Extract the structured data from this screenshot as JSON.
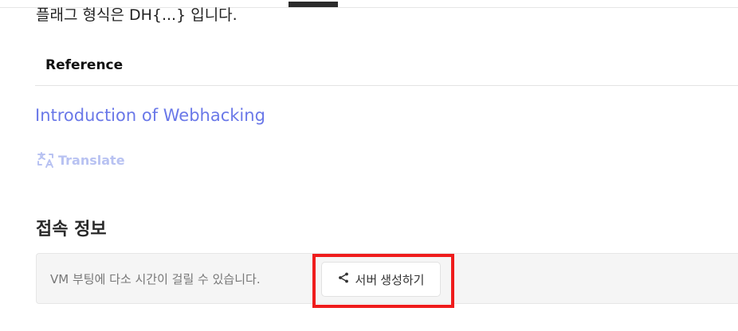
{
  "flag_format_text": "플래그 형식은 DH{...} 입니다.",
  "reference": {
    "heading": "Reference",
    "link_text": "Introduction of Webhacking"
  },
  "translate": {
    "label": "Translate",
    "icon": "translate-icon"
  },
  "connection": {
    "title": "접속 정보",
    "notice": "VM 부팅에 다소 시간이 걸릴 수 있습니다.",
    "server_button_label": "서버 생성하기",
    "server_button_icon": "share-icon"
  },
  "colors": {
    "link": "#6a78e8",
    "translate": "#b8c2f2",
    "highlight": "#ef1c1c"
  }
}
